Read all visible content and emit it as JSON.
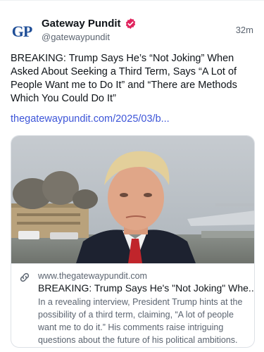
{
  "post": {
    "avatar_text": "GP",
    "display_name": "Gateway Pundit",
    "handle": "@gatewaypundit",
    "time": "32m",
    "text": "BREAKING: Trump Says He’s “Not Joking” When Asked About Seeking a Third Term, Says “A Lot of People Want me to Do It” and “There are Methods Which You Could Do It”",
    "link": "thegatewaypundit.com/2025/03/b..."
  },
  "card": {
    "domain": "www.thegatewaypundit.com",
    "title": "BREAKING: Trump Says He's \"Not Joking\" Whe...",
    "description": "In a revealing interview, President Trump hints at the possibility of a third term, claiming, “A lot of people want me to do it.” His comments raise intriguing questions about the future of his political ambitions."
  },
  "icons": {
    "verified": "verified-badge-icon",
    "link": "link-icon"
  },
  "colors": {
    "verified_badge": "#e0245e",
    "link": "#3d55d8",
    "brand": "#1f4e97"
  }
}
